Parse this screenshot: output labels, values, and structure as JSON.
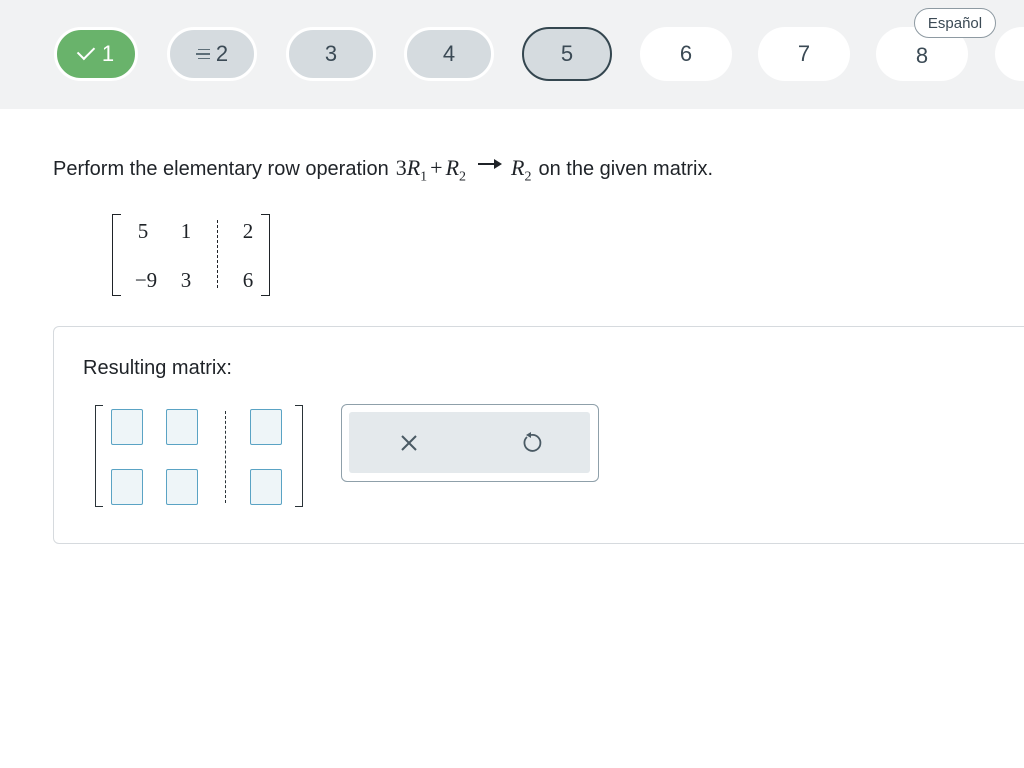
{
  "nav": {
    "questions": [
      {
        "label": "1",
        "state": "done"
      },
      {
        "label": "2",
        "state": "seen"
      },
      {
        "label": "3",
        "state": "seen"
      },
      {
        "label": "4",
        "state": "seen"
      },
      {
        "label": "5",
        "state": "current"
      },
      {
        "label": "6",
        "state": "new"
      },
      {
        "label": "7",
        "state": "new"
      },
      {
        "label": "8",
        "state": "new"
      }
    ],
    "language_button": "Español"
  },
  "question": {
    "prefix": "Perform the elementary row operation",
    "operation": {
      "coef": "3",
      "r1": "R",
      "r1_sub": "1",
      "plus": "+",
      "r2": "R",
      "r2_sub": "2",
      "target": "R",
      "target_sub": "2"
    },
    "suffix": "on the given matrix.",
    "matrix": {
      "rows": [
        [
          "5",
          "1",
          "2"
        ],
        [
          "−9",
          "3",
          "6"
        ]
      ]
    }
  },
  "answer": {
    "label": "Resulting matrix:",
    "clear_icon": "close-icon",
    "reset_icon": "undo-icon"
  },
  "colors": {
    "done": "#69b36b",
    "seen": "#d5dbdf",
    "current_border": "#34464f",
    "input_border": "#5aa3c4"
  }
}
